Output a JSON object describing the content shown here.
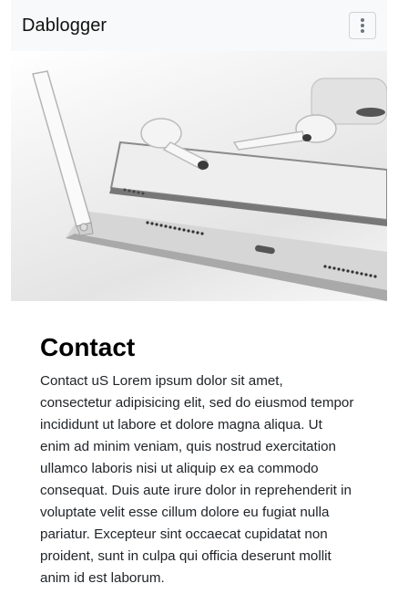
{
  "navbar": {
    "brand": "Dablogger",
    "menu_icon": "kebab-menu-icon"
  },
  "hero": {
    "image_subject": "tablet, smartphone, earbuds and stylus on a desk"
  },
  "main": {
    "title": "Contact",
    "body": "Contact uS Lorem ipsum dolor sit amet, consectetur adipisicing elit, sed do eiusmod tempor incididunt ut labore et dolore magna aliqua. Ut enim ad minim veniam, quis nostrud exercitation ullamco laboris nisi ut aliquip ex ea commodo consequat. Duis aute irure dolor in reprehenderit in voluptate velit esse cillum dolore eu fugiat nulla pariatur. Excepteur sint occaecat cupidatat non proident, sunt in culpa qui officia deserunt mollit anim id est laborum."
  },
  "colors": {
    "navbar_bg": "#f8f9fa",
    "text": "#212529",
    "title": "#000000"
  }
}
